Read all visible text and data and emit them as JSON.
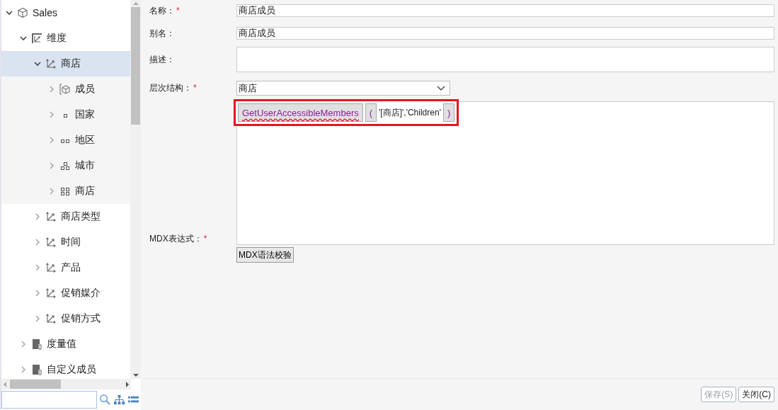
{
  "tree": [
    {
      "label": "Sales",
      "kind": "cube",
      "expanded": true,
      "selected": false,
      "children": [
        {
          "label": "维度",
          "kind": "dimensions",
          "expanded": true,
          "selected": false,
          "children": [
            {
              "label": "商店",
              "kind": "axis",
              "expanded": true,
              "selected": true,
              "children": [
                {
                  "label": "成员",
                  "kind": "member",
                  "expanded": false,
                  "selected": false
                },
                {
                  "label": "国家",
                  "kind": "level1",
                  "expanded": false,
                  "selected": false
                },
                {
                  "label": "地区",
                  "kind": "level2",
                  "expanded": false,
                  "selected": false
                },
                {
                  "label": "城市",
                  "kind": "level3",
                  "expanded": false,
                  "selected": false
                },
                {
                  "label": "商店",
                  "kind": "level4",
                  "expanded": false,
                  "selected": false
                }
              ]
            },
            {
              "label": "商店类型",
              "kind": "axis",
              "expanded": false,
              "selected": false
            },
            {
              "label": "时间",
              "kind": "axis",
              "expanded": false,
              "selected": false
            },
            {
              "label": "产品",
              "kind": "axis",
              "expanded": false,
              "selected": false
            },
            {
              "label": "促销媒介",
              "kind": "axis",
              "expanded": false,
              "selected": false
            },
            {
              "label": "促销方式",
              "kind": "axis",
              "expanded": false,
              "selected": false
            }
          ]
        },
        {
          "label": "度量值",
          "kind": "measure",
          "expanded": false,
          "selected": false
        },
        {
          "label": "自定义成员",
          "kind": "measure",
          "expanded": false,
          "selected": false
        }
      ]
    }
  ],
  "form": {
    "name": {
      "label": "名称：",
      "required_mark": "*",
      "value": "商店成员"
    },
    "alias": {
      "label": "别名：",
      "value": "商店成员"
    },
    "description": {
      "label": "描述："
    },
    "hierarchy": {
      "label": "层次结构：",
      "required_mark": "*",
      "value": "商店"
    },
    "mdx": {
      "label": "MDX表达式：",
      "required_mark": "*",
      "highlighted": true,
      "tokens": [
        {
          "kind": "function",
          "text": "GetUserAccessibleMembers"
        },
        {
          "kind": "paren",
          "text": "("
        },
        {
          "kind": "text",
          "text": "'[商店]','Children'"
        },
        {
          "kind": "paren",
          "text": ")"
        }
      ],
      "check_button": "MDX语法校验"
    }
  },
  "buttons": [
    {
      "label": "保存(S)",
      "disabled": true
    },
    {
      "label": "关闭(C)",
      "disabled": false
    }
  ]
}
